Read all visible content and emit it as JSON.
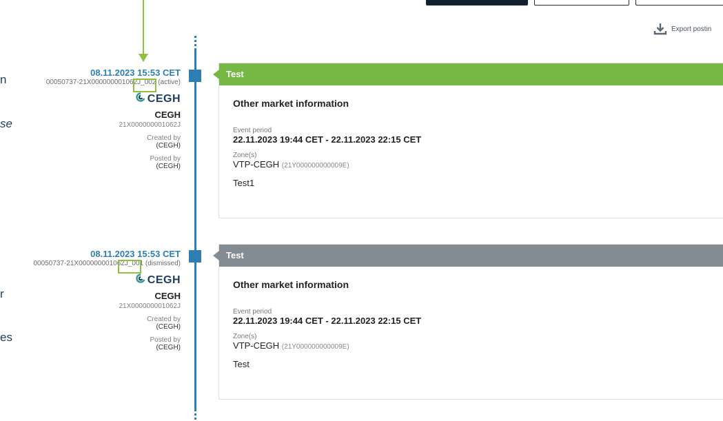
{
  "colors": {
    "active": "#76b843",
    "dismissed": "#838b93",
    "timeline": "#2e7fb1",
    "annotation": "#8fbf3e",
    "date": "#2c7fb6"
  },
  "toolbar": {
    "export_label": "Export postin",
    "export_icon": "download-icon"
  },
  "left_cut": [
    "n",
    "se",
    "r",
    "es"
  ],
  "entries": [
    {
      "date": "08.11.2023 15:53 CET",
      "id_prefix": "00050737-21X000000001062J_",
      "version": "002",
      "status": " (active)",
      "logo": "CEGH",
      "org": "CEGH",
      "eic": "21X000000001062J",
      "created_label": "Created by",
      "created_by": "(CEGH)",
      "posted_label": "Posted by",
      "posted_by": "(CEGH)",
      "card": {
        "title": "Test",
        "type": "Other market information",
        "period_label": "Event period",
        "period": "22.11.2023 19:44 CET - 22.11.2023 22:15 CET",
        "zone_label": "Zone(s)",
        "zone": "VTP-CEGH",
        "zone_code": "(21Y000000000009E)",
        "text": "Test1"
      }
    },
    {
      "date": "08.11.2023 15:53 CET",
      "id_prefix": "00050737-21X000000001062J_",
      "version": "001",
      "status": " (dismissed)",
      "logo": "CEGH",
      "org": "CEGH",
      "eic": "21X000000001062J",
      "created_label": "Created by",
      "created_by": "(CEGH)",
      "posted_label": "Posted by",
      "posted_by": "(CEGH)",
      "card": {
        "title": "Test",
        "type": "Other market information",
        "period_label": "Event period",
        "period": "22.11.2023 19:44 CET - 22.11.2023 22:15 CET",
        "zone_label": "Zone(s)",
        "zone": "VTP-CEGH",
        "zone_code": "(21Y000000000009E)",
        "text": "Test"
      }
    }
  ]
}
